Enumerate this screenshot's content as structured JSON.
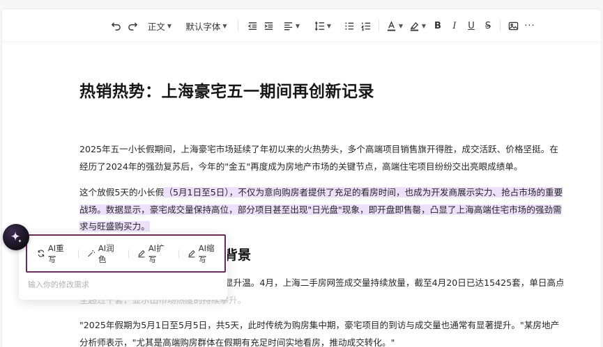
{
  "toolbar": {
    "paragraph_style": "正文",
    "font_family": "默认字体",
    "icons": [
      "undo-icon",
      "redo-icon",
      "indent-decrease-icon",
      "indent-increase-icon",
      "align-icon",
      "line-spacing-icon",
      "bullet-list-icon",
      "numbered-list-icon",
      "font-color-icon",
      "highlight-icon",
      "bold-icon",
      "italic-icon",
      "underline-icon",
      "strikethrough-icon",
      "image-icon",
      "more-icon"
    ]
  },
  "document": {
    "title": "热销热势：上海豪宅五一期间再创新记录",
    "para1": "2025年五一小长假期间，上海豪宅市场延续了年初以来的火热势头，多个高端项目销售旗开得胜，成交活跃、价格坚挺。在经历了2024年的强劲复苏后，今年的\"金五\"再度成为房地产市场的关键节点，高端住宅项目纷纷交出亮眼成绩单。",
    "para2_plain": "这个放假5天的小长假",
    "para2_selected": "（5月1日至5日），不仅为意向购房者提供了充足的看房时间，也成为开发商展示实力、抢占市场的重要战场。数据显示，豪宅成交量保持高位，部分项目甚至出现\"日光盘\"现象，即开盘即售罄，凸显了上海高端住宅市场的强劲需求与旺盛购买力。",
    "heading2": "背景",
    "para3_visible": "显升温。4月，上海二手房网签成交量持续放量，截至4月20日已达15425套，单日高点甚",
    "para3_line2": "至超过千套，显示出市场热度的持续攀升。",
    "para4": "\"2025年假期为5月1日至5月5日，共5天，此时传统为购房集中期，豪宅项目的到访与成交量也通常有显著提升。\"某房地产分析师表示，\"尤其是高端购房群体在假期有充足时间实地看房，推动成交转化。\""
  },
  "ai_panel": {
    "actions": [
      {
        "label": "AI重写",
        "icon": "rewrite-icon"
      },
      {
        "label": "AI润色",
        "icon": "magic-wand-icon"
      },
      {
        "label": "AI扩写",
        "icon": "pen-icon"
      },
      {
        "label": "AI缩写",
        "icon": "pen-icon"
      }
    ],
    "input_placeholder": "输入你的修改需求"
  },
  "colors": {
    "selection": "#ece0fb",
    "ai_panel_border": "#6b2a5e",
    "ai_badge": "#1a1622"
  }
}
